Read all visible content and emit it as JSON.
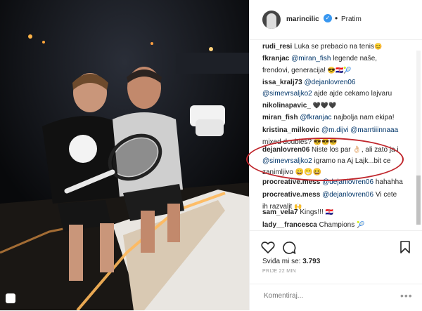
{
  "header": {
    "username": "marincilic",
    "verified_mark": "✓",
    "separator": "•",
    "follow_label": "Pratim"
  },
  "comments": [
    {
      "user": "rudi_resi",
      "parts": [
        {
          "t": "Luka se prebacio na tenis"
        }
      ],
      "emoji": "😊"
    },
    {
      "user": "fkranjac",
      "parts": [
        {
          "m": "@miran_fish"
        },
        {
          "t": " legende naše,"
        }
      ],
      "line2": "frendovi, generacija!",
      "emoji": "😎🇭🇷🎾"
    },
    {
      "user": "issa_kralj73",
      "parts": [
        {
          "m": "@dejanlovren06"
        }
      ],
      "line2_mention": "@simevrsaljko2",
      "line2": " ajde ajde cekamo lajvaru"
    },
    {
      "user": "nikolinapavic_",
      "parts": [],
      "emoji": "🖤🖤🖤"
    },
    {
      "user": "miran_fish",
      "parts": [
        {
          "m": "@fkranjac"
        },
        {
          "t": " najbolja nam ekipa!"
        }
      ]
    },
    {
      "user": "kristina_milkovic",
      "parts": [
        {
          "m": "@m.dijvi"
        },
        {
          "t": " "
        },
        {
          "m": "@marrtiiinnaaa"
        }
      ],
      "line2": "mixed doubles?",
      "emoji": "😎😎😎"
    },
    {
      "user": "dejanlovren06",
      "parts": [
        {
          "t": "Niste los par 👌🏻, ali zato ja i"
        }
      ],
      "line2_mention": "@simevrsaljko2",
      "line2": " igramo na Aj Lajk...bit ce",
      "line3": "zanimljivo 😄😁😆"
    },
    {
      "user": "procreative.mess",
      "parts": [
        {
          "m": "@dejanlovren06"
        },
        {
          "t": " hahahha"
        }
      ]
    },
    {
      "user": "procreative.mess",
      "parts": [
        {
          "m": "@dejanlovren06"
        },
        {
          "t": " Vi cete"
        }
      ],
      "line2": "ih razvalit",
      "emoji": "🙌"
    },
    {
      "user": "sam_vela7",
      "parts": [
        {
          "t": "Kings!!! "
        }
      ],
      "emoji": "🇭🇷"
    },
    {
      "user": "lady__francesca",
      "parts": [
        {
          "t": "Champions "
        }
      ],
      "emoji": "🎾"
    }
  ],
  "likes": {
    "label": "Sviđa mi se: ",
    "count": "3.793"
  },
  "time": "PRIJE 22 MIN",
  "add_comment": {
    "placeholder": "Komentiraj...",
    "more": "•••"
  },
  "icons": [
    "heart-icon",
    "comment-icon",
    "bookmark-icon",
    "verified-icon"
  ],
  "colors": {
    "mention": "#003569",
    "highlight": "#c0262c",
    "verified": "#3897f0"
  }
}
